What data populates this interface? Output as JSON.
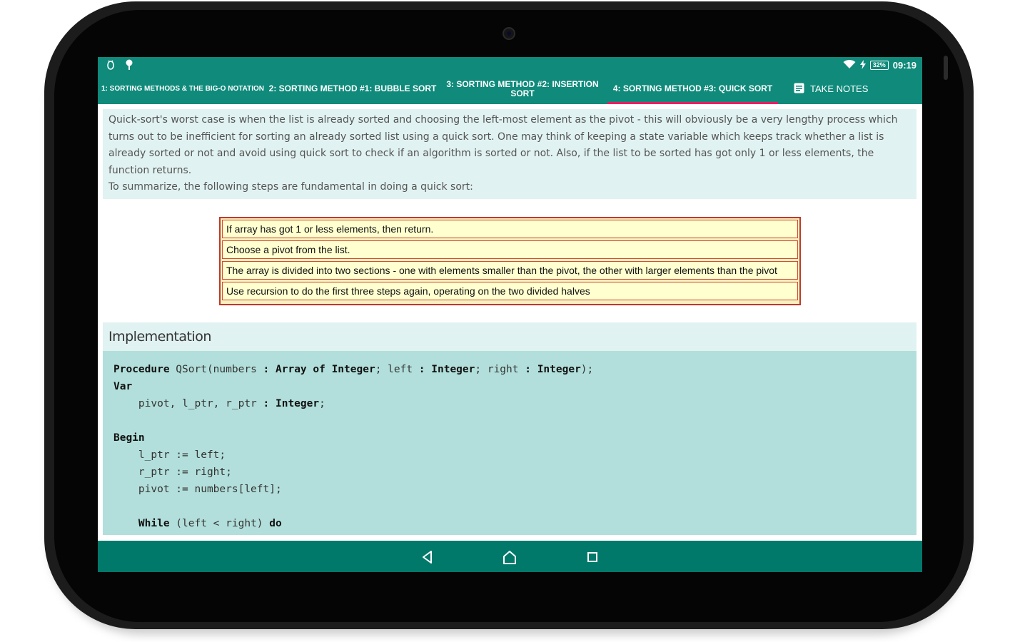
{
  "status_bar": {
    "time": "09:19",
    "battery": "32%",
    "icons": [
      "debug-icon",
      "usb-icon",
      "wifi-icon",
      "charging-icon",
      "battery-icon"
    ]
  },
  "tabs": [
    {
      "label": "1: SORTING METHODS & THE BIG-O NOTATION",
      "active": false
    },
    {
      "label": "2: SORTING METHOD #1: BUBBLE SORT",
      "active": false
    },
    {
      "label": "3: SORTING METHOD #2: INSERTION SORT",
      "active": false
    },
    {
      "label": "4: SORTING METHOD #3: QUICK SORT",
      "active": true
    }
  ],
  "take_notes": {
    "label": "TAKE NOTES",
    "icon": "notes-icon"
  },
  "content": {
    "paragraph1": "Quick-sort's worst case is when the list is already sorted and choosing the left-most element as the pivot - this will obviously be a very lengthy process which turns out to be inefficient for sorting an already sorted list using a quick sort. One may think of keeping a state variable which keeps track whether a list is already sorted or not and avoid using quick sort to check if an algorithm is sorted or not. Also, if the list to be sorted has got only 1 or less elements, the function returns.",
    "paragraph2": "To summarize, the following steps are fundamental in doing a quick sort:",
    "steps": [
      "If array has got 1 or less elements, then return.",
      "Choose a pivot from the list.",
      "The array is divided into two sections - one with elements smaller than the pivot, the other with larger elements than the pivot",
      "Use recursion to do the first three steps again, operating on the two divided halves"
    ],
    "implementation_title": "Implementation",
    "code_lines": [
      "Procedure QSort(numbers : Array of Integer; left : Integer; right : Integer);",
      "Var",
      "    pivot, l_ptr, r_ptr : Integer;",
      "",
      "Begin",
      "    l_ptr := left;",
      "    r_ptr := right;",
      "    pivot := numbers[left];",
      "",
      "    While (left < right) do"
    ]
  },
  "nav_bar": {
    "buttons": [
      "back-icon",
      "home-icon",
      "recents-icon"
    ]
  },
  "colors": {
    "primary": "#0f8a7b",
    "nav": "#00796b",
    "indicator": "#e91e63",
    "intro_bg": "#e0f2f1",
    "code_bg": "#b2dfdb",
    "step_border": "#c0392b",
    "step_bg": "#ffffd0"
  }
}
